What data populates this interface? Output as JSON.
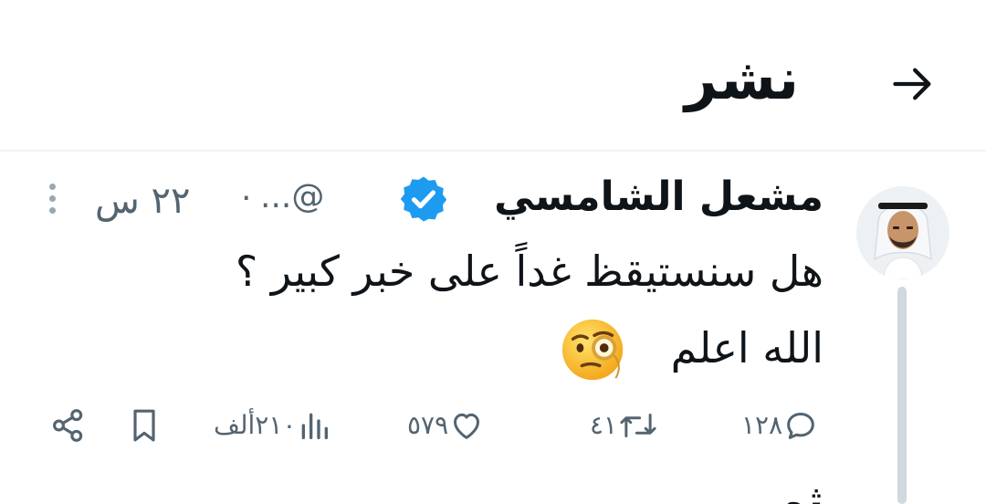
{
  "header": {
    "title": "نشر",
    "back_icon": "arrow-right-icon"
  },
  "tweet": {
    "display_name": "مشعل الشامسي",
    "verified": true,
    "verified_color": "#1d9bf0",
    "handle": "...@",
    "separator": "·",
    "time": "٢٢ س",
    "text_line1": "هل سنستيقظ غداً على خبر كبير ؟",
    "text_line2": "الله اعلم",
    "emoji": "face-with-monocle",
    "actions": {
      "replies": "١٢٨",
      "retweets": "٤١",
      "likes": "٥٧٩",
      "views": "٢١٠ألف"
    },
    "next_partial_text": "ثم"
  }
}
